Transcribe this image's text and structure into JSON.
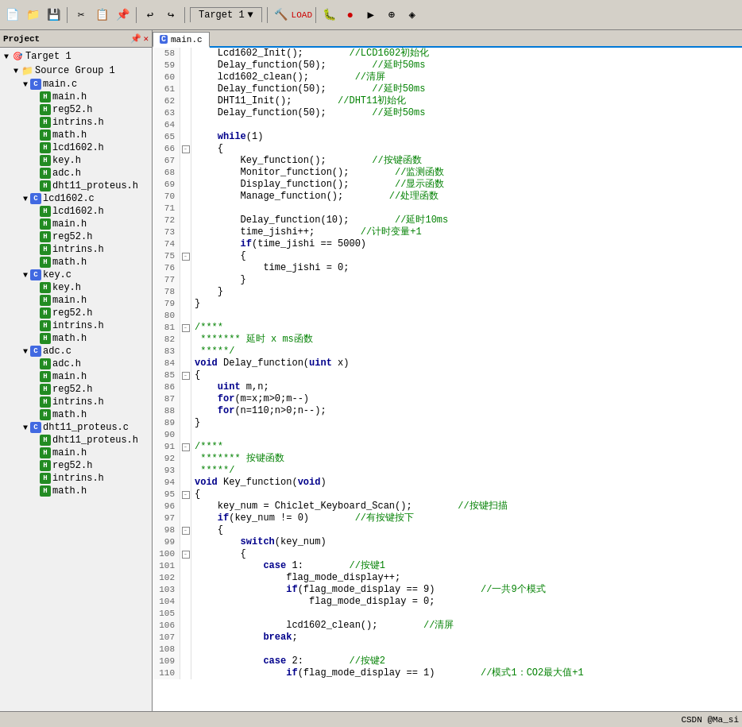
{
  "app": {
    "title": "Target 1",
    "toolbar_icons": [
      "new",
      "open",
      "save",
      "cut",
      "copy",
      "paste",
      "undo",
      "redo",
      "build",
      "load",
      "debug",
      "run",
      "step",
      "stepover",
      "stepout",
      "reset",
      "stop"
    ]
  },
  "sidebar": {
    "header": "Project",
    "tree": [
      {
        "id": "target1",
        "label": "Target 1",
        "level": 0,
        "type": "target",
        "expanded": true
      },
      {
        "id": "srcgroup1",
        "label": "Source Group 1",
        "level": 1,
        "type": "group",
        "expanded": true
      },
      {
        "id": "main_c",
        "label": "main.c",
        "level": 2,
        "type": "c"
      },
      {
        "id": "main_h",
        "label": "main.h",
        "level": 3,
        "type": "h"
      },
      {
        "id": "reg52_h",
        "label": "reg52.h",
        "level": 3,
        "type": "h"
      },
      {
        "id": "intrins_h",
        "label": "intrins.h",
        "level": 3,
        "type": "h"
      },
      {
        "id": "math_h",
        "label": "math.h",
        "level": 3,
        "type": "h"
      },
      {
        "id": "lcd1602_h",
        "label": "lcd1602.h",
        "level": 3,
        "type": "h"
      },
      {
        "id": "key_h",
        "label": "key.h",
        "level": 3,
        "type": "h"
      },
      {
        "id": "adc_h",
        "label": "adc.h",
        "level": 3,
        "type": "h"
      },
      {
        "id": "dht11_h",
        "label": "dht11_proteus.h",
        "level": 3,
        "type": "h"
      },
      {
        "id": "lcd1602_c",
        "label": "lcd1602.c",
        "level": 2,
        "type": "c"
      },
      {
        "id": "lcd1602_h2",
        "label": "lcd1602.h",
        "level": 3,
        "type": "h"
      },
      {
        "id": "main_h2",
        "label": "main.h",
        "level": 3,
        "type": "h"
      },
      {
        "id": "reg52_h2",
        "label": "reg52.h",
        "level": 3,
        "type": "h"
      },
      {
        "id": "intrins_h2",
        "label": "intrins.h",
        "level": 3,
        "type": "h"
      },
      {
        "id": "math_h2",
        "label": "math.h",
        "level": 3,
        "type": "h"
      },
      {
        "id": "key_c",
        "label": "key.c",
        "level": 2,
        "type": "c"
      },
      {
        "id": "key_h2",
        "label": "key.h",
        "level": 3,
        "type": "h"
      },
      {
        "id": "main_h3",
        "label": "main.h",
        "level": 3,
        "type": "h"
      },
      {
        "id": "reg52_h3",
        "label": "reg52.h",
        "level": 3,
        "type": "h"
      },
      {
        "id": "intrins_h3",
        "label": "intrins.h",
        "level": 3,
        "type": "h"
      },
      {
        "id": "math_h3",
        "label": "math.h",
        "level": 3,
        "type": "h"
      },
      {
        "id": "adc_c",
        "label": "adc.c",
        "level": 2,
        "type": "c"
      },
      {
        "id": "adc_h2",
        "label": "adc.h",
        "level": 3,
        "type": "h"
      },
      {
        "id": "main_h4",
        "label": "main.h",
        "level": 3,
        "type": "h"
      },
      {
        "id": "reg52_h4",
        "label": "reg52.h",
        "level": 3,
        "type": "h"
      },
      {
        "id": "intrins_h4",
        "label": "intrins.h",
        "level": 3,
        "type": "h"
      },
      {
        "id": "math_h4",
        "label": "math.h",
        "level": 3,
        "type": "h"
      },
      {
        "id": "dht11_c",
        "label": "dht11_proteus.c",
        "level": 2,
        "type": "c"
      },
      {
        "id": "dht11_h2",
        "label": "dht11_proteus.h",
        "level": 3,
        "type": "h"
      },
      {
        "id": "main_h5",
        "label": "main.h",
        "level": 3,
        "type": "h"
      },
      {
        "id": "reg52_h5",
        "label": "reg52.h",
        "level": 3,
        "type": "h"
      },
      {
        "id": "intrins_h5",
        "label": "intrins.h",
        "level": 3,
        "type": "h"
      },
      {
        "id": "math_h5",
        "label": "math.h",
        "level": 3,
        "type": "h"
      }
    ]
  },
  "editor": {
    "tab": "main.c",
    "lines": [
      {
        "num": 58,
        "fold": "",
        "content": "    Lcd1602_Init();",
        "comment": "//LCD1602初始化"
      },
      {
        "num": 59,
        "fold": "",
        "content": "    Delay_function(50);",
        "comment": "//延时50ms"
      },
      {
        "num": 60,
        "fold": "",
        "content": "    lcd1602_clean();",
        "comment": "//清屏"
      },
      {
        "num": 61,
        "fold": "",
        "content": "    Delay_function(50);",
        "comment": "//延时50ms"
      },
      {
        "num": 62,
        "fold": "",
        "content": "    DHT11_Init();",
        "comment": "//DHT11初始化"
      },
      {
        "num": 63,
        "fold": "",
        "content": "    Delay_function(50);",
        "comment": "//延时50ms"
      },
      {
        "num": 64,
        "fold": "",
        "content": "",
        "comment": ""
      },
      {
        "num": 65,
        "fold": "",
        "content": "    while(1)",
        "comment": ""
      },
      {
        "num": 66,
        "fold": "-",
        "content": "    {",
        "comment": ""
      },
      {
        "num": 67,
        "fold": "",
        "content": "        Key_function();",
        "comment": "//按键函数"
      },
      {
        "num": 68,
        "fold": "",
        "content": "        Monitor_function();",
        "comment": "//监测函数"
      },
      {
        "num": 69,
        "fold": "",
        "content": "        Display_function();",
        "comment": "//显示函数"
      },
      {
        "num": 70,
        "fold": "",
        "content": "        Manage_function();",
        "comment": "//处理函数"
      },
      {
        "num": 71,
        "fold": "",
        "content": "",
        "comment": ""
      },
      {
        "num": 72,
        "fold": "",
        "content": "        Delay_function(10);",
        "comment": "//延时10ms"
      },
      {
        "num": 73,
        "fold": "",
        "content": "        time_jishi++;",
        "comment": "//计时变量+1"
      },
      {
        "num": 74,
        "fold": "",
        "content": "        if(time_jishi == 5000)",
        "comment": ""
      },
      {
        "num": 75,
        "fold": "-",
        "content": "        {",
        "comment": ""
      },
      {
        "num": 76,
        "fold": "",
        "content": "            time_jishi = 0;",
        "comment": ""
      },
      {
        "num": 77,
        "fold": "",
        "content": "        }",
        "comment": ""
      },
      {
        "num": 78,
        "fold": "",
        "content": "    }",
        "comment": ""
      },
      {
        "num": 79,
        "fold": "",
        "content": "}",
        "comment": ""
      },
      {
        "num": 80,
        "fold": "",
        "content": "",
        "comment": ""
      },
      {
        "num": 81,
        "fold": "-",
        "content": "/****",
        "comment": ""
      },
      {
        "num": 82,
        "fold": "",
        "content": " ******* 延时 x ms函数",
        "comment": ""
      },
      {
        "num": 83,
        "fold": "",
        "content": " *****/",
        "comment": ""
      },
      {
        "num": 84,
        "fold": "",
        "content": "void Delay_function(uint x)",
        "comment": ""
      },
      {
        "num": 85,
        "fold": "-",
        "content": "{",
        "comment": ""
      },
      {
        "num": 86,
        "fold": "",
        "content": "    uint m,n;",
        "comment": ""
      },
      {
        "num": 87,
        "fold": "",
        "content": "    for(m=x;m>0;m--)",
        "comment": ""
      },
      {
        "num": 88,
        "fold": "",
        "content": "    for(n=110;n>0;n--);",
        "comment": ""
      },
      {
        "num": 89,
        "fold": "",
        "content": "}",
        "comment": ""
      },
      {
        "num": 90,
        "fold": "",
        "content": "",
        "comment": ""
      },
      {
        "num": 91,
        "fold": "-",
        "content": "/****",
        "comment": ""
      },
      {
        "num": 92,
        "fold": "",
        "content": " ******* 按键函数",
        "comment": ""
      },
      {
        "num": 93,
        "fold": "",
        "content": " *****/",
        "comment": ""
      },
      {
        "num": 94,
        "fold": "",
        "content": "void Key_function(void)",
        "comment": ""
      },
      {
        "num": 95,
        "fold": "-",
        "content": "{",
        "comment": ""
      },
      {
        "num": 96,
        "fold": "",
        "content": "    key_num = Chiclet_Keyboard_Scan();",
        "comment": "//按键扫描"
      },
      {
        "num": 97,
        "fold": "",
        "content": "    if(key_num != 0)",
        "comment": "//有按键按下"
      },
      {
        "num": 98,
        "fold": "-",
        "content": "    {",
        "comment": ""
      },
      {
        "num": 99,
        "fold": "",
        "content": "        switch(key_num)",
        "comment": ""
      },
      {
        "num": 100,
        "fold": "-",
        "content": "        {",
        "comment": ""
      },
      {
        "num": 101,
        "fold": "",
        "content": "            case 1:",
        "comment": "//按键1"
      },
      {
        "num": 102,
        "fold": "",
        "content": "                flag_mode_display++;",
        "comment": ""
      },
      {
        "num": 103,
        "fold": "",
        "content": "                if(flag_mode_display == 9)",
        "comment": "//一共9个模式"
      },
      {
        "num": 104,
        "fold": "",
        "content": "                    flag_mode_display = 0;",
        "comment": ""
      },
      {
        "num": 105,
        "fold": "",
        "content": "",
        "comment": ""
      },
      {
        "num": 106,
        "fold": "",
        "content": "                lcd1602_clean();",
        "comment": "//清屏"
      },
      {
        "num": 107,
        "fold": "",
        "content": "            break;",
        "comment": ""
      },
      {
        "num": 108,
        "fold": "",
        "content": "",
        "comment": ""
      },
      {
        "num": 109,
        "fold": "",
        "content": "            case 2:",
        "comment": "//按键2"
      },
      {
        "num": 110,
        "fold": "",
        "content": "                if(flag_mode_display == 1)",
        "comment": "//模式1：CO2最大值+1"
      }
    ]
  },
  "statusbar": {
    "text": "CSDN @Ma_si"
  }
}
